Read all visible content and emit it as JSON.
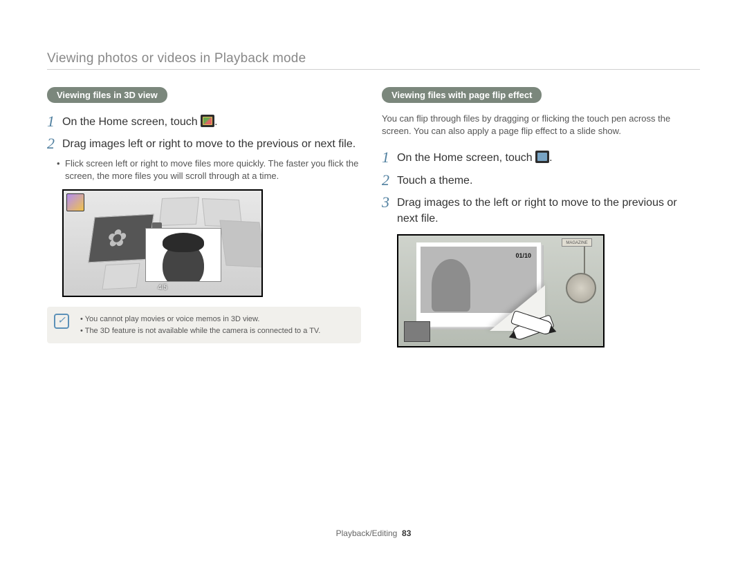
{
  "page_title": "Viewing photos or videos in Playback mode",
  "left": {
    "header": "Viewing files in 3D view",
    "steps": [
      {
        "num": "1",
        "text_a": "On the Home screen, touch ",
        "text_b": "."
      },
      {
        "num": "2",
        "text": "Drag images left or right to move to the previous or next file."
      }
    ],
    "bullet": "Flick screen left or right to move files more quickly. The faster you flick the screen, the more files you will scroll through at a time.",
    "shot_counter": "4/5",
    "notes": [
      "You cannot play movies or voice memos in 3D view.",
      "The 3D feature is not available while the camera is connected to a TV."
    ]
  },
  "right": {
    "header": "Viewing files with page flip effect",
    "intro": "You can flip through files by dragging or flicking the touch pen across the screen. You can also apply a page flip effect to a slide show.",
    "steps": [
      {
        "num": "1",
        "text_a": "On the Home screen, touch ",
        "text_b": "."
      },
      {
        "num": "2",
        "text": "Touch a theme."
      },
      {
        "num": "3",
        "text": "Drag images to the left or right to move to the previous or next file."
      }
    ],
    "shot_counter": "01/10",
    "card_label": "MAGAZINE"
  },
  "footer": {
    "section": "Playback/Editing",
    "page": "83"
  }
}
